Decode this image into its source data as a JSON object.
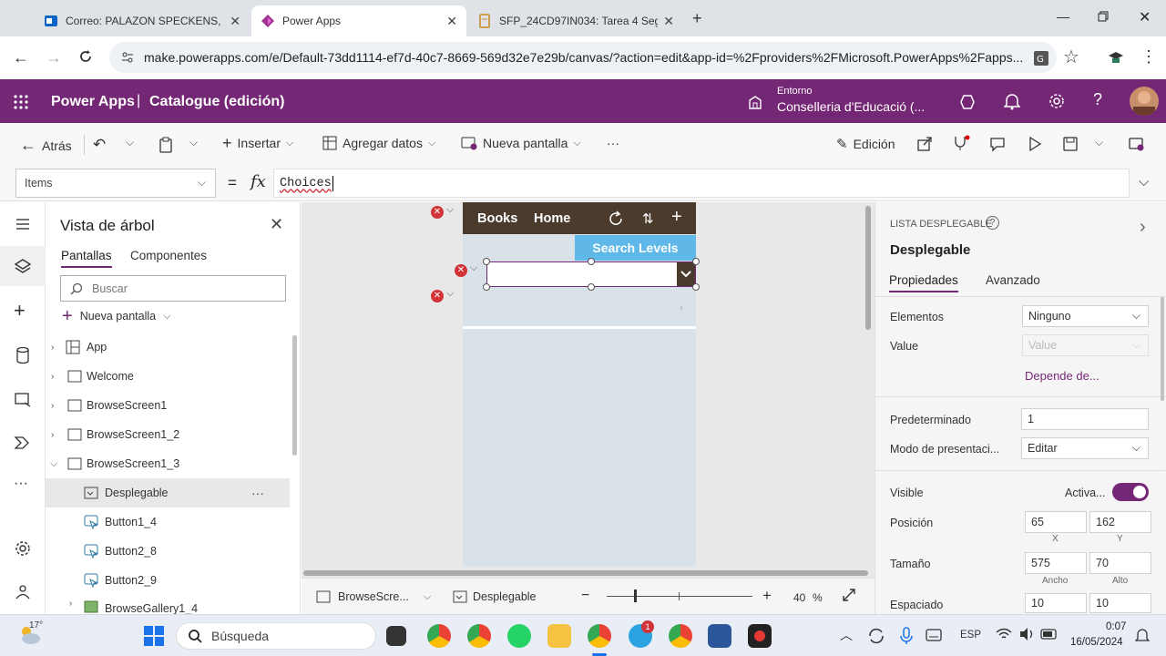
{
  "browser": {
    "tabs": [
      {
        "title": "Correo: PALAZON SPECKENS, N"
      },
      {
        "title": "Power Apps"
      },
      {
        "title": "SFP_24CD97IN034: Tarea 4 Seg"
      }
    ],
    "url": "make.powerapps.com/e/Default-73dd1114-ef7d-40c7-8669-569d32e7e29b/canvas/?action=edit&app-id=%2Fproviders%2FMicrosoft.PowerApps%2Fapps..."
  },
  "header": {
    "product": "Power Apps",
    "separator": "|",
    "app_title": "Catalogue (edición)",
    "env_label": "Entorno",
    "env_name": "Conselleria d'Educació (..."
  },
  "command_bar": {
    "back": "Atrás",
    "insert": "Insertar",
    "add_data": "Agregar datos",
    "new_screen": "Nueva pantalla",
    "more": "···",
    "edit_mode": "Edición"
  },
  "formula_bar": {
    "property": "Items",
    "equals": "=",
    "fx": "fx",
    "formula": "Choices"
  },
  "tree_view": {
    "title": "Vista de árbol",
    "tabs": [
      "Pantallas",
      "Componentes"
    ],
    "search_placeholder": "Buscar",
    "new_screen": "Nueva pantalla",
    "items": [
      {
        "label": "App"
      },
      {
        "label": "Welcome"
      },
      {
        "label": "BrowseScreen1"
      },
      {
        "label": "BrowseScreen1_2"
      },
      {
        "label": "BrowseScreen1_3"
      },
      {
        "label": "Desplegable"
      },
      {
        "label": "Button1_4"
      },
      {
        "label": "Button2_8"
      },
      {
        "label": "Button2_9"
      },
      {
        "label": "BrowseGallery1_4"
      }
    ],
    "row_more": "···"
  },
  "canvas": {
    "nav_books": "Books",
    "nav_home": "Home",
    "search_button": "Search Levels",
    "zoom": "40",
    "zoom_unit": "%",
    "screen_label": "BrowseScre...",
    "control_label": "Desplegable",
    "accent_color": "#4a3b2c",
    "search_button_color": "#5fb8e8"
  },
  "properties": {
    "section_label": "LISTA DESPLEGABLE",
    "control_name": "Desplegable",
    "tabs": [
      "Propiedades",
      "Avanzado"
    ],
    "elements_label": "Elementos",
    "elements_value": "Ninguno",
    "value_label": "Value",
    "value_placeholder": "Value",
    "depends_link": "Depende de...",
    "default_label": "Predeterminado",
    "default_value": "1",
    "display_mode_label": "Modo de presentaci...",
    "display_mode_value": "Editar",
    "visible_label": "Visible",
    "visible_state": "Activa...",
    "position_label": "Posición",
    "pos_x": "65",
    "pos_y": "162",
    "x_label": "X",
    "y_label": "Y",
    "size_label": "Tamaño",
    "width": "575",
    "height": "70",
    "width_label": "Ancho",
    "height_label": "Alto",
    "spacing_label": "Espaciado",
    "spacing_1": "10",
    "spacing_2": "10"
  },
  "taskbar": {
    "temperature": "17°",
    "search_placeholder": "Búsqueda",
    "lang": "ESP",
    "time": "0:07",
    "date": "16/05/2024",
    "badge": "1"
  }
}
